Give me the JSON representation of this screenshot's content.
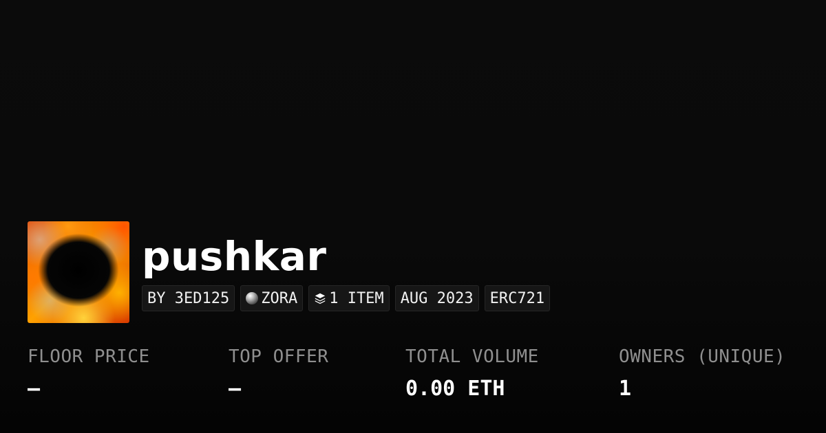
{
  "collection": {
    "name": "pushkar",
    "tags": {
      "creator": "BY 3ED125",
      "chain": "ZORA",
      "chain_icon": "zora-orb-icon",
      "items": "1 ITEM",
      "items_icon": "layers-icon",
      "date": "AUG 2023",
      "standard": "ERC721"
    }
  },
  "stats": {
    "floor_price": {
      "label": "FLOOR PRICE",
      "value": "—"
    },
    "top_offer": {
      "label": "TOP OFFER",
      "value": "—"
    },
    "total_volume": {
      "label": "TOTAL VOLUME",
      "value": "0.00 ETH"
    },
    "owners": {
      "label": "OWNERS (UNIQUE)",
      "value": "1"
    }
  },
  "colors": {
    "background": "#0a0a0a",
    "tag_background": "#161616",
    "label": "#8f8f8f",
    "text": "#ffffff"
  }
}
